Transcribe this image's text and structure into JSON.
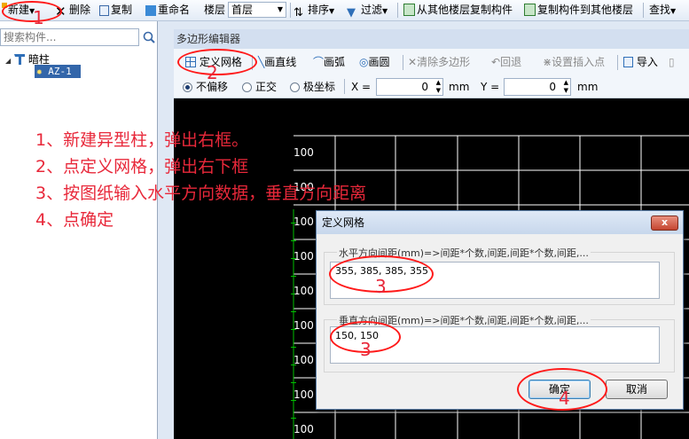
{
  "toolbar": {
    "new": "新建",
    "delete": "删除",
    "copy": "复制",
    "rename": "重命名",
    "floor_label": "楼层",
    "floor_value": "首层",
    "sort": "排序",
    "filter": "过滤",
    "copy_from_floor": "从其他楼层复制构件",
    "copy_to_floor": "复制构件到其他楼层",
    "find": "查找"
  },
  "left_panel": {
    "search_placeholder": "搜索构件...",
    "tree": {
      "root": "暗柱",
      "child": "AZ-1"
    }
  },
  "editor": {
    "title": "多边形编辑器",
    "tools": [
      "定义网格",
      "画直线",
      "画弧",
      "画圆",
      "清除多边形",
      "回退",
      "设置插入点",
      "导入"
    ],
    "options": {
      "no_offset": "不偏移",
      "orthogonal": "正交",
      "polar": "极坐标",
      "x_label": "X =",
      "x_value": "0",
      "y_label": "Y =",
      "y_value": "0",
      "unit": "mm"
    },
    "grid_label": "100"
  },
  "dialog": {
    "title": "定义网格",
    "close": "x",
    "horizontal_label": "水平方向间距(mm)=>间距*个数,间距,间距*个数,间距,...",
    "horizontal_value": "355, 385, 385, 355",
    "vertical_label": "垂直方向间距(mm)=>间距*个数,间距,间距*个数,间距,...",
    "vertical_value": "150, 150",
    "ok": "确定",
    "cancel": "取消"
  },
  "annotations": {
    "step1": "1、新建异型柱，弹出右框。",
    "step2": "2、点定义网格，弹出右下框",
    "step3": "3、按图纸输入水平方向数据，垂直方向距离",
    "step4": "4、点确定",
    "n1": "1",
    "n2": "2",
    "n3a": "3",
    "n3b": "3",
    "n4": "4"
  },
  "colors": {
    "annotation": "#e8283a",
    "canvas": "#000000",
    "grid": "#ffffff",
    "axis": "#00c000"
  }
}
